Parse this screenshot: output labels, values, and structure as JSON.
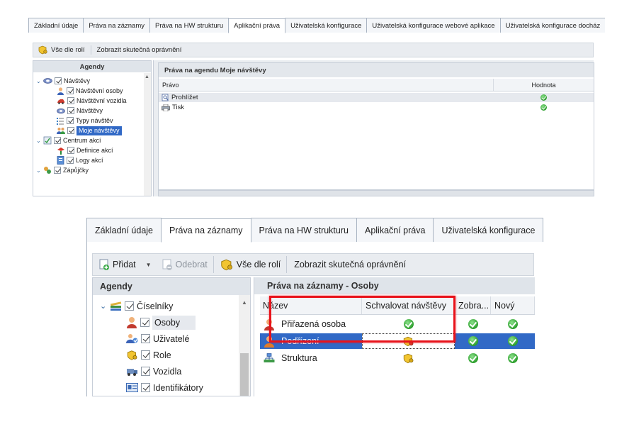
{
  "top": {
    "tabs": [
      "Základní údaje",
      "Práva na záznamy",
      "Práva na HW strukturu",
      "Aplikační práva",
      "Uživatelská konfigurace",
      "Uživatelská konfigurace webové aplikace",
      "Uživatelská konfigurace docház"
    ],
    "active_tab_index": 3,
    "toolbar": {
      "by_roles": "Vše dle rolí",
      "show_actual": "Zobrazit skutečná oprávnění"
    },
    "agendy_title": "Agendy",
    "tree": [
      {
        "label": "Návštěvy",
        "icon": "visits-icon",
        "level": 0,
        "expanded": true
      },
      {
        "label": "Návštěvní osoby",
        "icon": "person-icon",
        "level": 1
      },
      {
        "label": "Návštěvní vozidla",
        "icon": "car-icon",
        "level": 1
      },
      {
        "label": "Návštěvy",
        "icon": "visits-icon",
        "level": 1
      },
      {
        "label": "Typy návštěv",
        "icon": "list-icon",
        "level": 1
      },
      {
        "label": "Moje návštěvy",
        "icon": "group-icon",
        "level": 1,
        "selected": true
      },
      {
        "label": "Centrum akcí",
        "icon": "actions-center-icon",
        "level": 0,
        "expanded": true
      },
      {
        "label": "Definice akcí",
        "icon": "pin-icon",
        "level": 1
      },
      {
        "label": "Logy akcí",
        "icon": "log-icon",
        "level": 1
      },
      {
        "label": "Zápůjčky",
        "icon": "loan-icon",
        "level": 0,
        "expanded": true
      }
    ],
    "panel_title": "Práva na agendu Moje návštěvy",
    "columns": {
      "right": "Právo",
      "value": "Hodnota"
    },
    "rows": [
      {
        "label": "Prohlížet",
        "icon": "view-icon"
      },
      {
        "label": "Tisk",
        "icon": "print-icon"
      }
    ]
  },
  "bottom": {
    "tabs": [
      "Základní údaje",
      "Práva na záznamy",
      "Práva na HW strukturu",
      "Aplikační práva",
      "Uživatelská konfigurace"
    ],
    "active_tab_index": 1,
    "toolbar": {
      "add": "Přidat",
      "remove": "Odebrat",
      "by_roles": "Vše dle rolí",
      "show_actual": "Zobrazit skutečná oprávnění"
    },
    "agendy_title": "Agendy",
    "tree": [
      {
        "label": "Číselníky",
        "icon": "books-icon",
        "level": 0,
        "expanded": true
      },
      {
        "label": "Osoby",
        "icon": "person-icon",
        "level": 1,
        "selected": true
      },
      {
        "label": "Uživatelé",
        "icon": "users-icon",
        "level": 1
      },
      {
        "label": "Role",
        "icon": "role-icon",
        "level": 1
      },
      {
        "label": "Vozidla",
        "icon": "vehicles-icon",
        "level": 1
      },
      {
        "label": "Identifikátory",
        "icon": "id-card-icon",
        "level": 1
      }
    ],
    "panel_title": "Práva na záznamy - Osoby",
    "columns": [
      "Název",
      "Schvalovat návštěvy",
      "Zobra...",
      "Nový"
    ],
    "rows": [
      {
        "label": "Přiřazená osoba",
        "icon": "person-icon"
      },
      {
        "label": "Podřízení",
        "icon": "person-icon",
        "selected": true
      },
      {
        "label": "Struktura",
        "icon": "structure-icon"
      }
    ]
  },
  "colors": {
    "selection": "#3169c6",
    "highlight_box": "#e8131b",
    "check_green": "#2c9e2c",
    "tab_border": "#a9b4c2"
  }
}
